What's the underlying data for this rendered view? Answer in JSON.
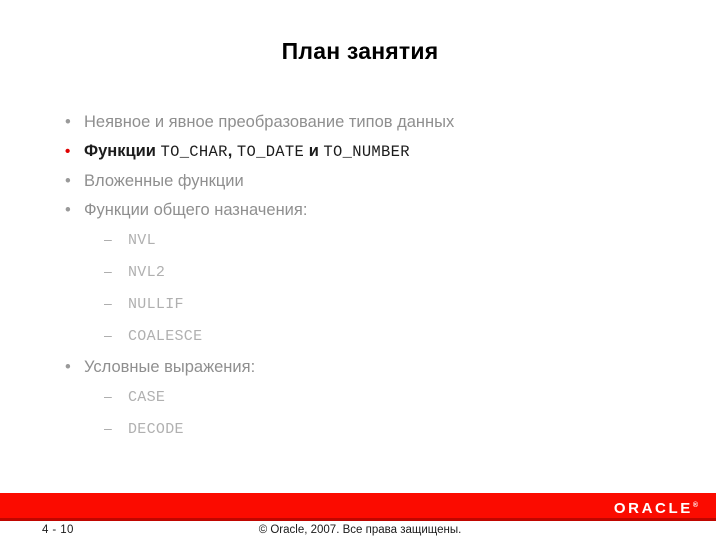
{
  "slide": {
    "title": "План занятия",
    "bullets": [
      {
        "level": 1,
        "marker": "•",
        "emphasis": false,
        "parts": [
          {
            "text": "Неявное и явное преобразование типов данных",
            "mono": false
          }
        ]
      },
      {
        "level": 1,
        "marker": "•",
        "emphasis": true,
        "parts": [
          {
            "text": "Функции ",
            "mono": false
          },
          {
            "text": "TO_CHAR",
            "mono": true
          },
          {
            "text": ", ",
            "mono": false
          },
          {
            "text": "TO_DATE",
            "mono": true
          },
          {
            "text": " и ",
            "mono": false
          },
          {
            "text": "TO_NUMBER",
            "mono": true
          }
        ]
      },
      {
        "level": 1,
        "marker": "•",
        "emphasis": false,
        "parts": [
          {
            "text": "Вложенные функции",
            "mono": false
          }
        ]
      },
      {
        "level": 1,
        "marker": "•",
        "emphasis": false,
        "parts": [
          {
            "text": "Функции общего назначения:",
            "mono": false
          }
        ]
      },
      {
        "level": 2,
        "marker": "–",
        "emphasis": false,
        "parts": [
          {
            "text": "NVL",
            "mono": true
          }
        ]
      },
      {
        "level": 2,
        "marker": "–",
        "emphasis": false,
        "parts": [
          {
            "text": "NVL2",
            "mono": true
          }
        ]
      },
      {
        "level": 2,
        "marker": "–",
        "emphasis": false,
        "parts": [
          {
            "text": "NULLIF",
            "mono": true
          }
        ]
      },
      {
        "level": 2,
        "marker": "–",
        "emphasis": false,
        "parts": [
          {
            "text": "COALESCE",
            "mono": true
          }
        ]
      },
      {
        "level": 1,
        "marker": "•",
        "emphasis": false,
        "parts": [
          {
            "text": "Условные выражения:",
            "mono": false
          }
        ]
      },
      {
        "level": 2,
        "marker": "–",
        "emphasis": false,
        "parts": [
          {
            "text": "CASE",
            "mono": true
          }
        ]
      },
      {
        "level": 2,
        "marker": "–",
        "emphasis": false,
        "parts": [
          {
            "text": "DECODE",
            "mono": true
          }
        ]
      }
    ]
  },
  "footer": {
    "brand": "ORACLE",
    "brand_trademark": "®",
    "page_number": "4 - 10",
    "copyright": "© Oracle, 2007. Все права защищены.",
    "bar_color": "#fb0b00",
    "bar_edge_color": "#c00600"
  }
}
